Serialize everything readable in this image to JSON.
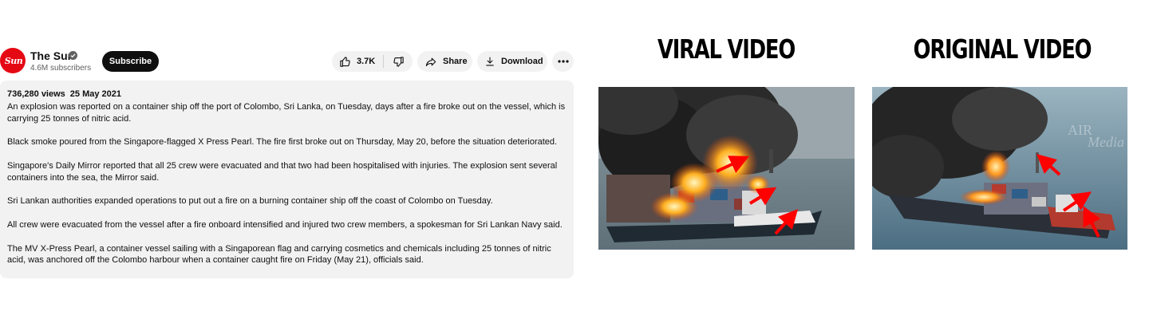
{
  "channel": {
    "avatar_text": "Sun",
    "name": "The Sun",
    "subscribers": "4.6M subscribers",
    "subscribe_label": "Subscribe"
  },
  "actions": {
    "like_count": "3.7K",
    "share_label": "Share",
    "download_label": "Download"
  },
  "description": {
    "views": "736,280 views",
    "date": "25 May 2021",
    "paragraphs": [
      "An explosion was reported on a container ship off the port of Colombo, Sri Lanka, on Tuesday, days after a fire broke out on the vessel, which is carrying 25 tonnes of nitric acid.",
      "Black smoke poured from the Singapore-flagged X Press Pearl. The fire first broke out on Thursday, May 20, before the situation deteriorated.",
      "Singapore's Daily Mirror reported that all 25 crew were evacuated and that two had been hospitalised with injuries. The explosion sent several containers into the sea, the Mirror said.",
      "Sri Lankan authorities expanded operations to put out a fire on a burning container ship off the coast of Colombo on Tuesday.",
      "All crew were evacuated from the vessel after a fire onboard intensified and injured two crew members, a spokesman for Sri Lankan Navy said.",
      "The MV X-Press Pearl, a container vessel sailing with a Singaporean flag and carrying cosmetics and chemicals including 25 tonnes of nitric acid, was anchored off the Colombo harbour when a container caught fire on Friday (May 21), officials said."
    ]
  },
  "comparison": {
    "viral_title": "VIRAL VIDEO",
    "original_title": "ORIGINAL VIDEO",
    "watermark": "AIR Media"
  },
  "colors": {
    "brand_red": "#e50914",
    "button_bg": "#f2f2f2",
    "subscribe_bg": "#0f0f0f",
    "arrow_red": "#ff0000"
  },
  "icons": [
    "verified-icon",
    "thumbs-up-icon",
    "thumbs-down-icon",
    "share-icon",
    "download-icon",
    "more-icon"
  ]
}
